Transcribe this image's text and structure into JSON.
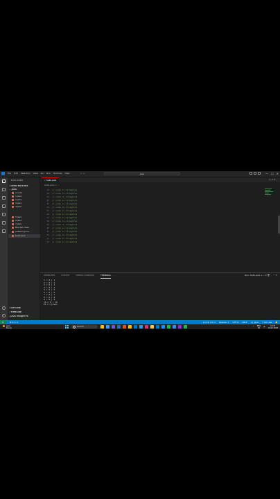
{
  "window": {
    "menu": [
      "File",
      "Edit",
      "Selection",
      "View",
      "Go",
      "Run",
      "Terminal",
      "Help"
    ],
    "nav_arrows": "←  →",
    "command_center": "Java",
    "controls": [
      "—",
      "☐",
      "✕"
    ]
  },
  "sidebar": {
    "title": "EXPLORER",
    "open_editors": "OPEN EDITORS",
    "folder": "JAVA",
    "files": [
      {
        "name": "a.code",
        "color": "#e76f51"
      },
      {
        "name": "1.java",
        "color": "#e76f51"
      },
      {
        "name": "2.java",
        "color": "#e76f51"
      },
      {
        "name": "3.java",
        "color": "#e76f51"
      },
      {
        "name": "4.java",
        "color": "#e76f51"
      },
      {
        "name": "5.java",
        "color": "#e76f51"
      },
      {
        "name": "6.java",
        "color": "#e76f51"
      },
      {
        "name": "7.java",
        "color": "#e76f51"
      },
      {
        "name": "Bracket.class",
        "color": "#e76f51"
      },
      {
        "name": "patterns.java",
        "color": "#e76f51"
      },
      {
        "name": "hello.java",
        "color": "#e76f51"
      }
    ],
    "outline": "OUTLINE",
    "timeline": "TIMELINE",
    "java_projects": "JAVA PROJECTS"
  },
  "editor": {
    "tab_label": "hello.java",
    "breadcrumb": "hello.java > ...",
    "actions": "▷ ∨  ⫴  ···",
    "line_numbers": [
      "19",
      "20",
      "21",
      "22",
      "23",
      "24",
      "25",
      "26",
      "27",
      "28",
      "29",
      "30",
      "31",
      "32",
      "33",
      "34"
    ]
  },
  "panel": {
    "tabs": [
      "PROBLEMS",
      "OUTPUT",
      "DEBUG CONSOLE",
      "TERMINAL"
    ],
    "active_tab": "TERMINAL",
    "actions": "Run: hello.java  +  ⌄  ⫴  🗑  ···  ^  ✕",
    "terminal_lines": [
      "1 = 8 | 1",
      "2 = 8 | 2",
      "3 = 8 | 3",
      "4 = 8 | 4",
      "5 = 8 | 5",
      "6 = 8 | 6",
      "7 = 8 | 7",
      "8 = 8 | 8",
      "9 = 8 | 9",
      "10 = 8 | 10",
      "PS C:\\java>"
    ]
  },
  "statusbar": {
    "left": "⊗ 0 ⚠ 0",
    "items": [
      "Ln 34, Col 1",
      "Spaces: 4",
      "UTF-8",
      "CRLF",
      "{} Java",
      "⚡ Go Live",
      "🔔"
    ]
  },
  "taskbar": {
    "temp": "29°C",
    "condition": "Sunny",
    "search_label": "Search",
    "lang_top": "ENG",
    "lang_bottom": "IN",
    "time": "10:47",
    "date": "13-07-2023",
    "app_colors": [
      "#f0c020",
      "#3aa0ff",
      "#6a5acd",
      "#2b6cb0",
      "#e34f26",
      "#ffb900",
      "#0078d4",
      "#3a96dd",
      "#e1306c",
      "#ffce44",
      "#0078d4",
      "#1e90ff",
      "#1db954",
      "#4285f4",
      "#8a2be2",
      "#1db954"
    ]
  },
  "colors": {
    "status_blue": "#007acc",
    "remote_green": "#16825d",
    "active_tab_accent": "#e51400"
  }
}
